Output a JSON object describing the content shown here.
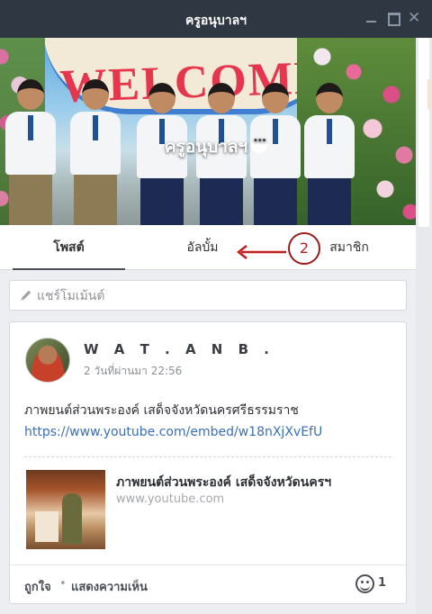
{
  "window": {
    "title": "ครูอนุบาลฯ"
  },
  "cover": {
    "welcome_text": "WELCOME",
    "group_name": "ครูอนุบาลฯ"
  },
  "tabs": [
    {
      "label": "โพสต์",
      "active": true
    },
    {
      "label": "อัลบั้ม",
      "active": false
    },
    {
      "label": "สมาชิก",
      "active": false
    }
  ],
  "annotation": {
    "number": "2",
    "color": "#b81e1e"
  },
  "composer": {
    "placeholder": "แชร์โมเม้นต์"
  },
  "post": {
    "author": "W A T . A N B .",
    "time": "2 วันที่ผ่านมา 22:56",
    "text": "ภาพยนต์ส่วนพระองค์ เสด็จจังหวัดนครศรีธรรมราช ",
    "url": "https://www.youtube.com/embed/w18nXjXvEfU",
    "link_preview": {
      "title": "ภาพยนต์ส่วนพระองค์ เสด็จจังหวัดนครฯ",
      "domain": "www.youtube.com"
    },
    "footer": {
      "like": "ถูกใจ",
      "separator": "•",
      "comment": "แสดงความเห็น",
      "reaction_count": "1"
    }
  },
  "colors": {
    "titlebar": "#2e3742",
    "link": "#3b6fb6",
    "background": "#edeef2"
  }
}
